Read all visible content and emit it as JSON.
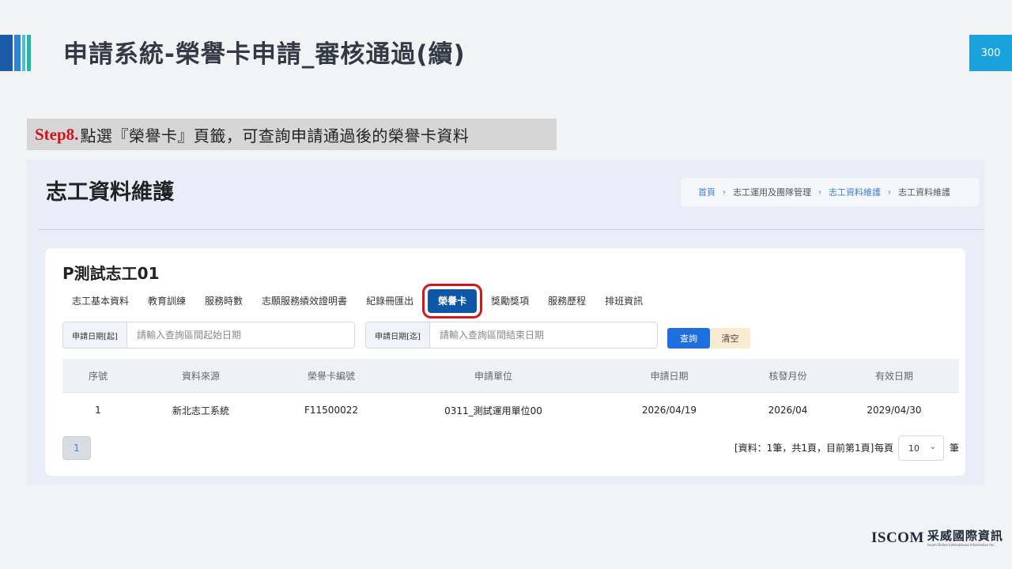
{
  "slide": {
    "title": "申請系統-榮譽卡申請_審核通過(續)",
    "page_number": "300",
    "step_prefix": "Step8.",
    "step_text": "點選『榮譽卡』頁籤，可查詢申請通過後的榮譽卡資料"
  },
  "screen": {
    "title": "志工資料維護",
    "breadcrumb": [
      "首頁",
      "志工運用及團隊管理",
      "志工資料維護",
      "志工資料維護"
    ],
    "volunteer_name": "P測試志工01",
    "tabs": [
      {
        "label": "志工基本資料"
      },
      {
        "label": "教育訓練"
      },
      {
        "label": "服務時數"
      },
      {
        "label": "志願服務績效證明書"
      },
      {
        "label": "紀錄冊匯出"
      },
      {
        "label": "榮譽卡"
      },
      {
        "label": "獎勵獎項"
      },
      {
        "label": "服務歷程"
      },
      {
        "label": "排班資訊"
      }
    ],
    "active_tab": "榮譽卡",
    "search": {
      "start_label": "申請日期[起]",
      "start_placeholder": "請輸入查詢區間起始日期",
      "start_value": "",
      "end_label": "申請日期[迄]",
      "end_placeholder": "請輸入查詢區間結束日期",
      "end_value": "",
      "query_label": "查詢",
      "clear_label": "清空"
    },
    "table": {
      "headers": [
        "序號",
        "資料來源",
        "榮譽卡編號",
        "申請單位",
        "申請日期",
        "核發月份",
        "有效日期"
      ],
      "rows": [
        [
          "1",
          "新北志工系統",
          "F11500022",
          "0311_測試運用單位00",
          "2026/04/19",
          "2026/04",
          "2029/04/30"
        ]
      ]
    },
    "pagination": {
      "current_page": "1",
      "info": "[資料：1筆，共1頁，目前第1頁]",
      "per_page_label": "每頁",
      "page_size": "10",
      "unit_label": "筆"
    }
  },
  "logo": {
    "en": "ISCOM",
    "zh": "采威國際資訊",
    "sub": "Iscom Online International Information Inc."
  },
  "colors": {
    "active_tab": "#0e57a6",
    "highlight_box": "#d7161c",
    "query_button": "#1d6fe0",
    "clear_button": "#f8ebcf",
    "page_number_bg": "#1aa2dc",
    "step_prefix": "#d0121b"
  }
}
